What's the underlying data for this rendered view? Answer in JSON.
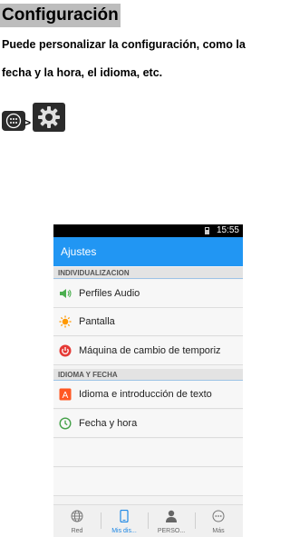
{
  "document": {
    "title": "Configuración",
    "paragraph_line_1": "Puede personalizar la configuración, como la",
    "paragraph_line_2": "fecha y la hora, el idioma, etc.",
    "navigation_hint": {
      "icons": [
        "apps-icon",
        "settings-gear-icon"
      ],
      "separator": ">"
    }
  },
  "phone": {
    "status_bar": {
      "time": "15:55",
      "icons": [
        "battery-icon"
      ]
    },
    "app_bar": {
      "title": "Ajustes",
      "color": "#2196f3"
    },
    "sections": [
      {
        "header": "INDIVIDUALIZACION",
        "items": [
          {
            "label": "Perfiles Audio",
            "icon": "speaker-icon",
            "icon_color": "#4caf50"
          },
          {
            "label": "Pantalla",
            "icon": "brightness-icon",
            "icon_color": "#ff9800"
          },
          {
            "label": "Máquina de cambio de temporiz",
            "icon": "power-icon",
            "icon_color": "#e53935"
          }
        ]
      },
      {
        "header": "IDIOMA Y FECHA",
        "items": [
          {
            "label": "Idioma e introducción de texto",
            "icon": "language-icon",
            "icon_color": "#ff5722"
          },
          {
            "label": "Fecha y hora",
            "icon": "clock-icon",
            "icon_color": "#43a047"
          }
        ]
      }
    ],
    "bottom_nav": [
      {
        "label": "Red",
        "icon": "globe-icon",
        "active": false
      },
      {
        "label": "Mis dis...",
        "icon": "phone-device-icon",
        "active": true
      },
      {
        "label": "PERSO...",
        "icon": "person-icon",
        "active": false
      },
      {
        "label": "Más",
        "icon": "more-icon",
        "active": false
      }
    ]
  }
}
